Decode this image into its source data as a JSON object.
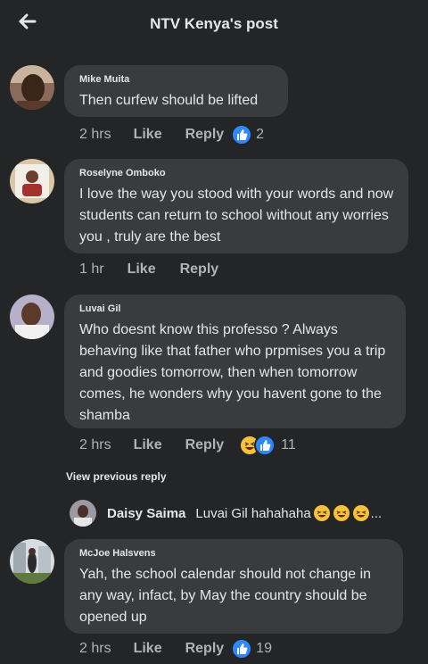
{
  "header": {
    "title": "NTV Kenya's post"
  },
  "comments": [
    {
      "author": "Mike Muita",
      "text": "Then curfew should be lifted",
      "time": "2 hrs",
      "like_label": "Like",
      "reply_label": "Reply",
      "reactions": [
        "like-icon"
      ],
      "reaction_count": "2"
    },
    {
      "author": "Roselyne Omboko",
      "text": "I love the way  you stood with your words and now students can return to school without any worries you , truly are the best",
      "time": "1 hr",
      "like_label": "Like",
      "reply_label": "Reply",
      "reactions": [],
      "reaction_count": ""
    },
    {
      "author": "Luvai Gil",
      "text": "Who doesnt know this professo ? Always behaving like that father who prpmises you a trip and goodies tomorrow, then when tomorrow comes, he wonders why you havent gone to the shamba",
      "time": "2 hrs",
      "like_label": "Like",
      "reply_label": "Reply",
      "reactions": [
        "haha-icon",
        "like-icon"
      ],
      "reaction_count": "11"
    },
    {
      "author": "McJoe Halsvens",
      "text": "Yah, the school calendar should not change in any way, infact, by May the country should be opened up",
      "time": "2 hrs",
      "like_label": "Like",
      "reply_label": "Reply",
      "reactions": [
        "like-icon"
      ],
      "reaction_count": "19"
    }
  ],
  "view_previous_reply": "View previous reply",
  "reply_preview": {
    "author": "Daisy Saima",
    "text": "Luvai Gil hahahaha",
    "ellipsis": "..."
  },
  "colors": {
    "background": "#242526",
    "bubble": "#3a3b3c",
    "like_blue": "#2d88ff",
    "haha_yellow": "#f7c23a",
    "secondary_text": "#b0b3b8"
  }
}
